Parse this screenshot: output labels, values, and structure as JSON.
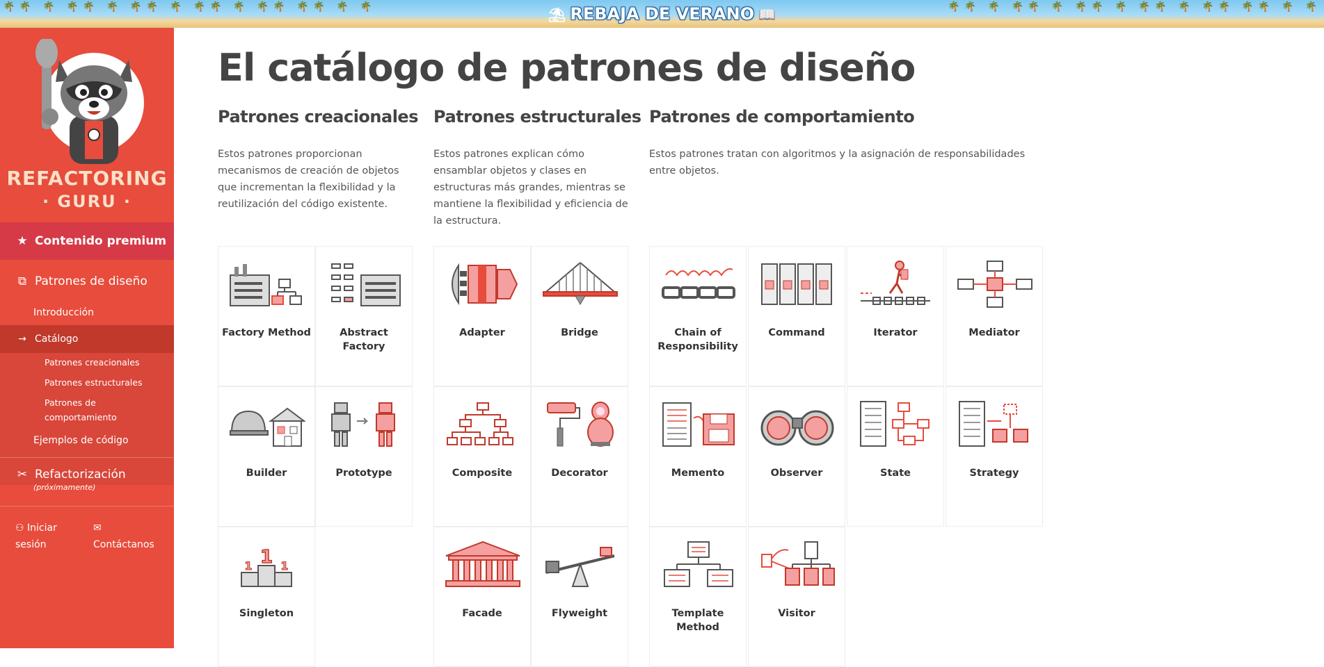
{
  "banner": {
    "text": "REBAJA DE VERANO"
  },
  "sidebar": {
    "logo_line1": "REFACTORING",
    "logo_line2": "· GURU ·",
    "premium": "Contenido premium",
    "design_patterns": "Patrones de diseño",
    "intro": "Introducción",
    "catalog": "Catálogo",
    "sub_creational": "Patrones creacionales",
    "sub_structural": "Patrones estructurales",
    "sub_behavioral": "Patrones de comportamiento",
    "code_examples": "Ejemplos de código",
    "refactoring": "Refactorización",
    "refactoring_note": "(próximamente)",
    "login": "Iniciar sesión",
    "contact": "Contáctanos"
  },
  "main": {
    "title": "El catálogo de patrones de diseño",
    "creational": {
      "heading": "Patrones creacionales",
      "description": "Estos patrones proporcionan mecanismos de creación de objetos que incrementan la flexibilidad y la reutilización del código existente.",
      "patterns": [
        "Factory Method",
        "Abstract Factory",
        "Builder",
        "Prototype",
        "Singleton"
      ]
    },
    "structural": {
      "heading": "Patrones estructurales",
      "description": "Estos patrones explican cómo ensamblar objetos y clases en estructuras más grandes, mientras se mantiene la flexibilidad y eficiencia de la estructura.",
      "patterns": [
        "Adapter",
        "Bridge",
        "Composite",
        "Decorator",
        "Facade",
        "Flyweight"
      ]
    },
    "behavioral": {
      "heading": "Patrones de comportamiento",
      "description": "Estos patrones tratan con algoritmos y la asignación de responsabilidades entre objetos.",
      "patterns": [
        "Chain of Responsibility",
        "Command",
        "Iterator",
        "Mediator",
        "Memento",
        "Observer",
        "State",
        "Strategy",
        "Template Method",
        "Visitor"
      ]
    }
  },
  "colors": {
    "sidebar": "#e74c3c",
    "accent_red": "#e74c3c",
    "icon_gray": "#666666",
    "title": "#444444"
  }
}
